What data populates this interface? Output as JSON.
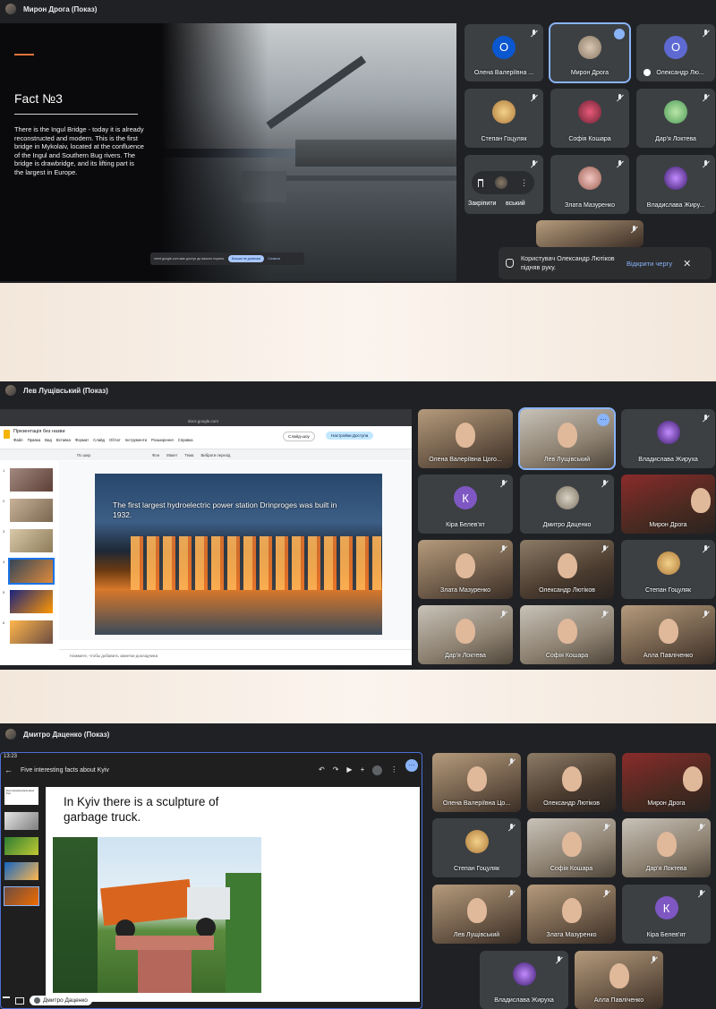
{
  "panel1": {
    "presenter": "Мирон Дрога (Показ)",
    "slide": {
      "title": "Fact №3",
      "body": "There is the Ingul Bridge - today it is already reconstructed and modern. This is the first bridge in Mykolaiv, located at the confluence of the Ingul and Southern Bug rivers. The bridge is drawbridge, and its lifting part is the largest in Europe."
    },
    "share_bar": {
      "text": "meet.google.com має доступ до вашого екрана.",
      "stop_label": "Більше не ділитися",
      "hide_label": "Сховати"
    },
    "tiles": [
      {
        "name": "Олена Валеріївна ...",
        "letter": "О",
        "color": "#0b57d0"
      },
      {
        "name": "Мирон Дрога"
      },
      {
        "name": "Олександр Лю...",
        "letter": "О",
        "color": "#5e6ad2"
      },
      {
        "name": "Степан Гоцуляк"
      },
      {
        "name": "Софія Кошара"
      },
      {
        "name": "Дар'я Локтева"
      },
      {
        "name": "вський"
      },
      {
        "name": "Злата Мазуренко"
      },
      {
        "name": "Владислава Жиру..."
      }
    ],
    "pin_label": "Закріпити",
    "toast": {
      "text": "Користувач Олександр Лютіков підняв руку.",
      "action": "Відкрити чергу"
    }
  },
  "panel2": {
    "presenter": "Лев Лущівський (Показ)",
    "browser": {
      "url": "docs.google.com"
    },
    "doc": {
      "title": "Презентація без назви",
      "menu": [
        "Файл",
        "Правка",
        "Вид",
        "Вставка",
        "Формат",
        "Слайд",
        "Об'єкт",
        "Інструменти",
        "Розширення",
        "Справка"
      ],
      "slideshow_label": "Слайд-шоу",
      "share_label": "Настройки Доступа",
      "toolbar": [
        "По шир.",
        "Фон",
        "Макет",
        "Тема",
        "Вибрати перехід"
      ],
      "slide_text": "The first largest hydroelectric power station Drinproges was built in 1932.",
      "notes_placeholder": "Нажмите, чтобы добавить заметки докладчика",
      "thumb_numbers": [
        "1",
        "2",
        "3",
        "4",
        "5",
        "6"
      ]
    },
    "tiles": [
      {
        "name": "Олена Валеріївна Цого..."
      },
      {
        "name": "Лев Лущівський"
      },
      {
        "name": "Владислава Жируха"
      },
      {
        "name": "Кіра Белев'ят",
        "letter": "К",
        "color": "#7e57c2"
      },
      {
        "name": "Дмитро Даценко"
      },
      {
        "name": "Мирон Дрога"
      },
      {
        "name": "Злата Мазуренко"
      },
      {
        "name": "Олександр Лютіков"
      },
      {
        "name": "Степан Гоцуляк"
      },
      {
        "name": "Дар'я Локтева"
      },
      {
        "name": "Софія Кошара"
      },
      {
        "name": "Алла Павліченко"
      }
    ]
  },
  "panel3": {
    "presenter": "Дмитро Даценко (Показ)",
    "time": "13:23",
    "deck_title": "Five interesting facts about Kyiv",
    "slide_text": "In Kyiv there is a  sculpture of garbage truck.",
    "thumb_title": "Five interesting facts about Kyiv",
    "self_label": "Дмитро Даценко",
    "tiles": [
      {
        "name": "Олена Валеріївна Цо..."
      },
      {
        "name": "Олександр Лютіков"
      },
      {
        "name": "Мирон Дрога"
      },
      {
        "name": "Степан Гоцуляк"
      },
      {
        "name": "Софія Кошара"
      },
      {
        "name": "Дар'я Локтева"
      },
      {
        "name": "Лев Лущівський"
      },
      {
        "name": "Злата Мазуренко"
      },
      {
        "name": "Кіра Белев'ят",
        "letter": "К",
        "color": "#7e57c2"
      },
      {
        "name": "Владислава Жируха"
      },
      {
        "name": "Алла Павліченко"
      }
    ]
  }
}
